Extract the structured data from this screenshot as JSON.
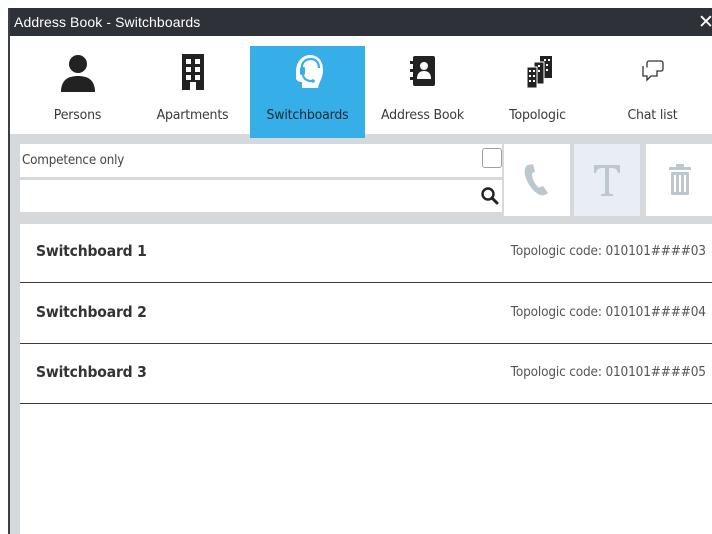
{
  "window": {
    "title": "Address Book - Switchboards",
    "close_label": "✕"
  },
  "tabs": [
    {
      "label": "Persons",
      "icon": "person-icon",
      "active": false
    },
    {
      "label": "Apartments",
      "icon": "building-icon",
      "active": false
    },
    {
      "label": "Switchboards",
      "icon": "headset-operator-icon",
      "active": true
    },
    {
      "label": "Address Book",
      "icon": "address-book-icon",
      "active": false
    },
    {
      "label": "Topologic",
      "icon": "buildings-icon",
      "active": false
    },
    {
      "label": "Chat list",
      "icon": "chat-icon",
      "active": false
    }
  ],
  "filters": {
    "competence_label": "Competence only",
    "competence_checked": false,
    "search_value": "",
    "search_placeholder": ""
  },
  "actions": [
    {
      "name": "call",
      "icon": "phone-icon"
    },
    {
      "name": "text",
      "icon": "text-t-icon"
    },
    {
      "name": "delete",
      "icon": "trash-icon"
    }
  ],
  "switchboards": [
    {
      "name": "Switchboard 1",
      "code": "Topologic code: 010101####03"
    },
    {
      "name": "Switchboard 2",
      "code": "Topologic code: 010101####04"
    },
    {
      "name": "Switchboard 3",
      "code": "Topologic code: 010101####05"
    }
  ],
  "colors": {
    "titlebar": "#2e3238",
    "active_tab": "#36aee8",
    "icon_dark": "#222222",
    "icon_muted": "#b8c4cc"
  }
}
